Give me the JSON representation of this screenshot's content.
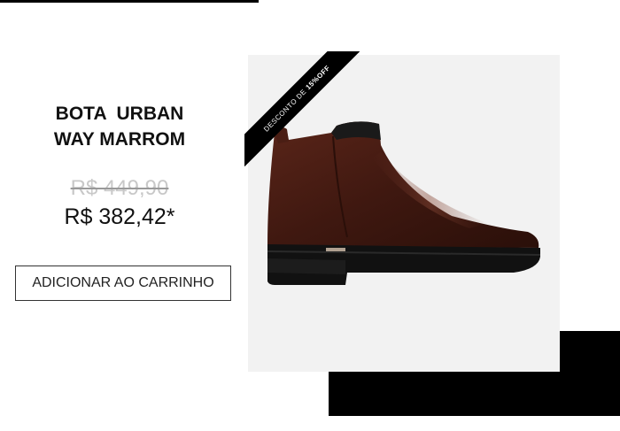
{
  "product": {
    "title_line1": "BOTA  URBAN",
    "title_line2": "WAY MARROM",
    "old_price": "R$ 449,90",
    "new_price": "R$ 382,42*",
    "add_to_cart_label": "ADICIONAR AO CARRINHO",
    "discount_label": "DESCONTO DE",
    "discount_value": "15%OFF"
  },
  "colors": {
    "accent": "#000000",
    "boot_leather": "#4a1e14",
    "panel_bg": "#f2f2f2"
  }
}
